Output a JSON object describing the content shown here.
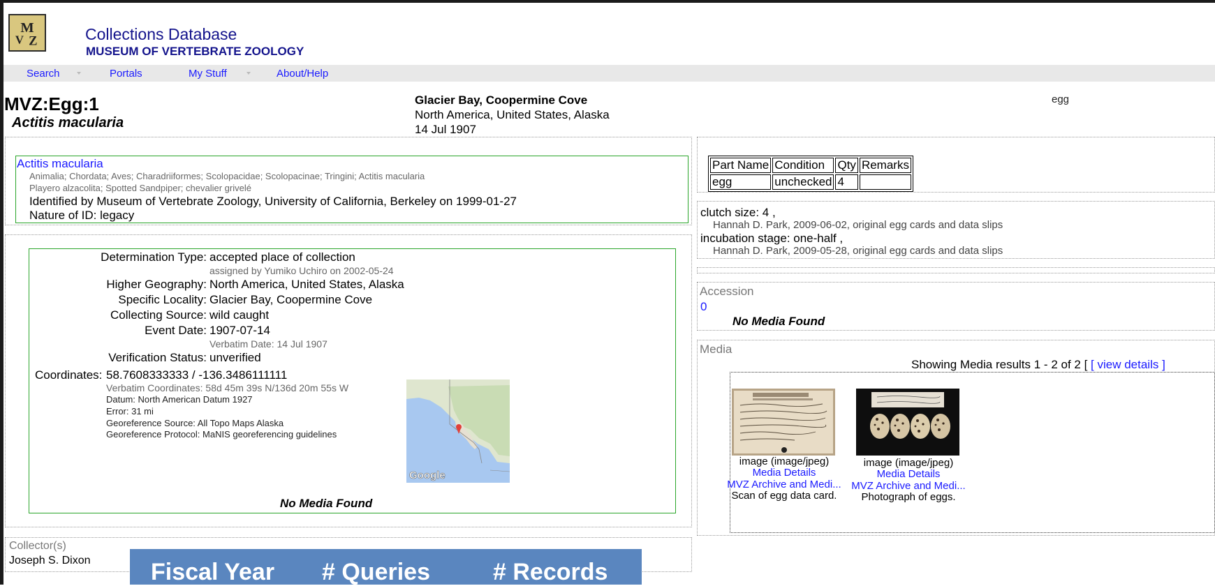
{
  "header": {
    "title": "Collections Database",
    "subtitle": "MUSEUM OF VERTEBRATE ZOOLOGY",
    "logo_text": "MVZ"
  },
  "nav": [
    "Search",
    "Portals",
    "My Stuff",
    "About/Help"
  ],
  "record": {
    "id": "MVZ:Egg:1",
    "taxon": "Actitis macularia",
    "locality_title": "Glacier Bay, Coopermine Cove",
    "geography": "North America, United States, Alaska",
    "date": "14 Jul 1907",
    "parts_summary": "egg"
  },
  "identification": {
    "name": "Actitis macularia",
    "classification": "Animalia; Chordata; Aves; Charadriiformes; Scolopacidae; Scolopacinae; Tringini; Actitis macularia",
    "common_names": "Playero alzacolita; Spotted Sandpiper; chevalier grivelé",
    "identified_by": "Identified by Museum of Vertebrate Zoology, University of California, Berkeley on 1999-01-27",
    "nature": "Nature of ID: legacy"
  },
  "locality": {
    "determination_type_label": "Determination Type:",
    "determination_type": "accepted place of collection",
    "assigned_by": "assigned by Yumiko Uchiro on 2002-05-24",
    "higher_geo_label": "Higher Geography:",
    "higher_geo": "North America, United States, Alaska",
    "specific_locality_label": "Specific Locality:",
    "specific_locality": "Glacier Bay, Coopermine Cove",
    "collecting_source_label": "Collecting Source:",
    "collecting_source": "wild caught",
    "event_date_label": "Event Date:",
    "event_date": "1907-07-14",
    "verbatim_date": "Verbatim Date: 14 Jul 1907",
    "verification_label": "Verification Status:",
    "verification": "unverified",
    "coordinates_label": "Coordinates:",
    "coordinates": "58.7608333333 / -136.3486111111",
    "verbatim_coords": "Verbatim Coordinates: 58d 45m 39s N/136d 20m 55s W",
    "datum": "Datum: North American Datum 1927",
    "error": "Error: 31 mi",
    "georef_source": "Georeference Source: All Topo Maps Alaska",
    "georef_protocol": "Georeference Protocol: MaNIS georeferencing guidelines",
    "map_brand": "Google",
    "no_media": "No Media Found"
  },
  "collectors": {
    "title": "Collector(s)",
    "name": "Joseph S. Dixon"
  },
  "parts_table": {
    "headers": [
      "Part Name",
      "Condition",
      "Qty",
      "Remarks"
    ],
    "row": [
      "egg",
      "unchecked",
      "4",
      ""
    ]
  },
  "attributes": {
    "clutch": "clutch size: 4 ,",
    "clutch_by": "Hannah D. Park, 2009-06-02, original egg cards and data slips",
    "incubation": "incubation stage: one-half ,",
    "incubation_by": "Hannah D. Park, 2009-05-28, original egg cards and data slips"
  },
  "accession": {
    "title": "Accession",
    "value": "0",
    "no_media": "No Media Found"
  },
  "media": {
    "title": "Media",
    "showing": "Showing Media results 1 - 2 of 2 [",
    "view_details": "[ view details ]",
    "items": [
      {
        "type": "image (image/jpeg)",
        "details": "Media Details",
        "archive": "MVZ Archive and Medi...",
        "caption": "Scan of egg data card."
      },
      {
        "type": "image (image/jpeg)",
        "details": "Media Details",
        "archive": "MVZ Archive and Medi...",
        "caption": "Photograph of eggs."
      }
    ]
  },
  "banner": {
    "col1": "Fiscal Year",
    "col2": "# Queries",
    "col3": "# Records"
  },
  "colors": {
    "title_blue": "#13138c",
    "link_blue": "#1a1aff",
    "box_green": "#2aa52a",
    "banner_blue": "#5a86bf"
  }
}
